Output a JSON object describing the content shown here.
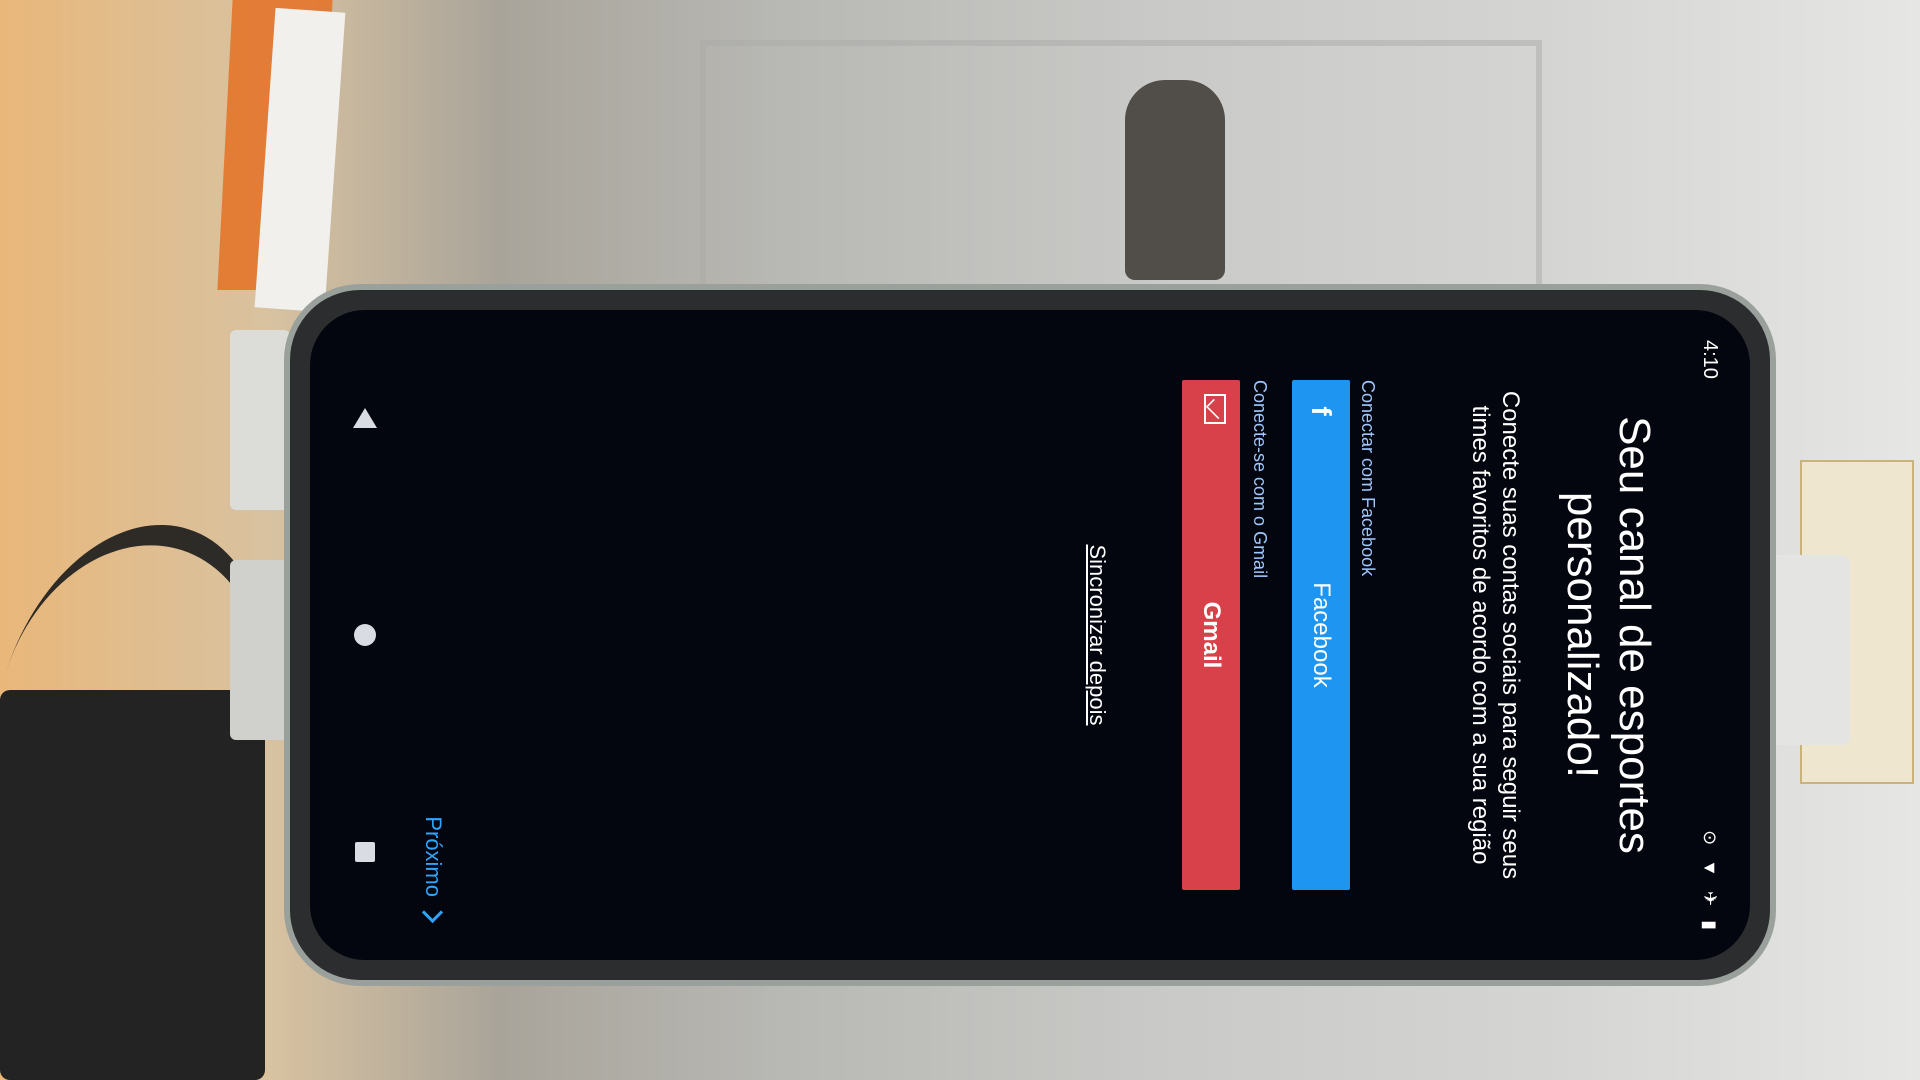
{
  "status_bar": {
    "time": "4:10",
    "icons": [
      "alarm-icon",
      "wifi-icon",
      "airplane-icon",
      "battery-icon"
    ]
  },
  "onboarding": {
    "title": "Seu canal de esportes personalizado!",
    "subtitle": "Conecte suas contas sociais para seguir seus times favoritos de acordo com a sua região",
    "facebook": {
      "caption": "Conectar com Facebook",
      "label": "Facebook",
      "color": "#1e95f0"
    },
    "gmail": {
      "caption": "Conecte-se com o Gmail",
      "label": "Gmail",
      "color": "#d8414a"
    },
    "sync_later": "Sincronizar depois",
    "next": "Próximo"
  },
  "nav_bar": {
    "icons": [
      "back-icon",
      "home-icon",
      "recents-icon"
    ]
  }
}
